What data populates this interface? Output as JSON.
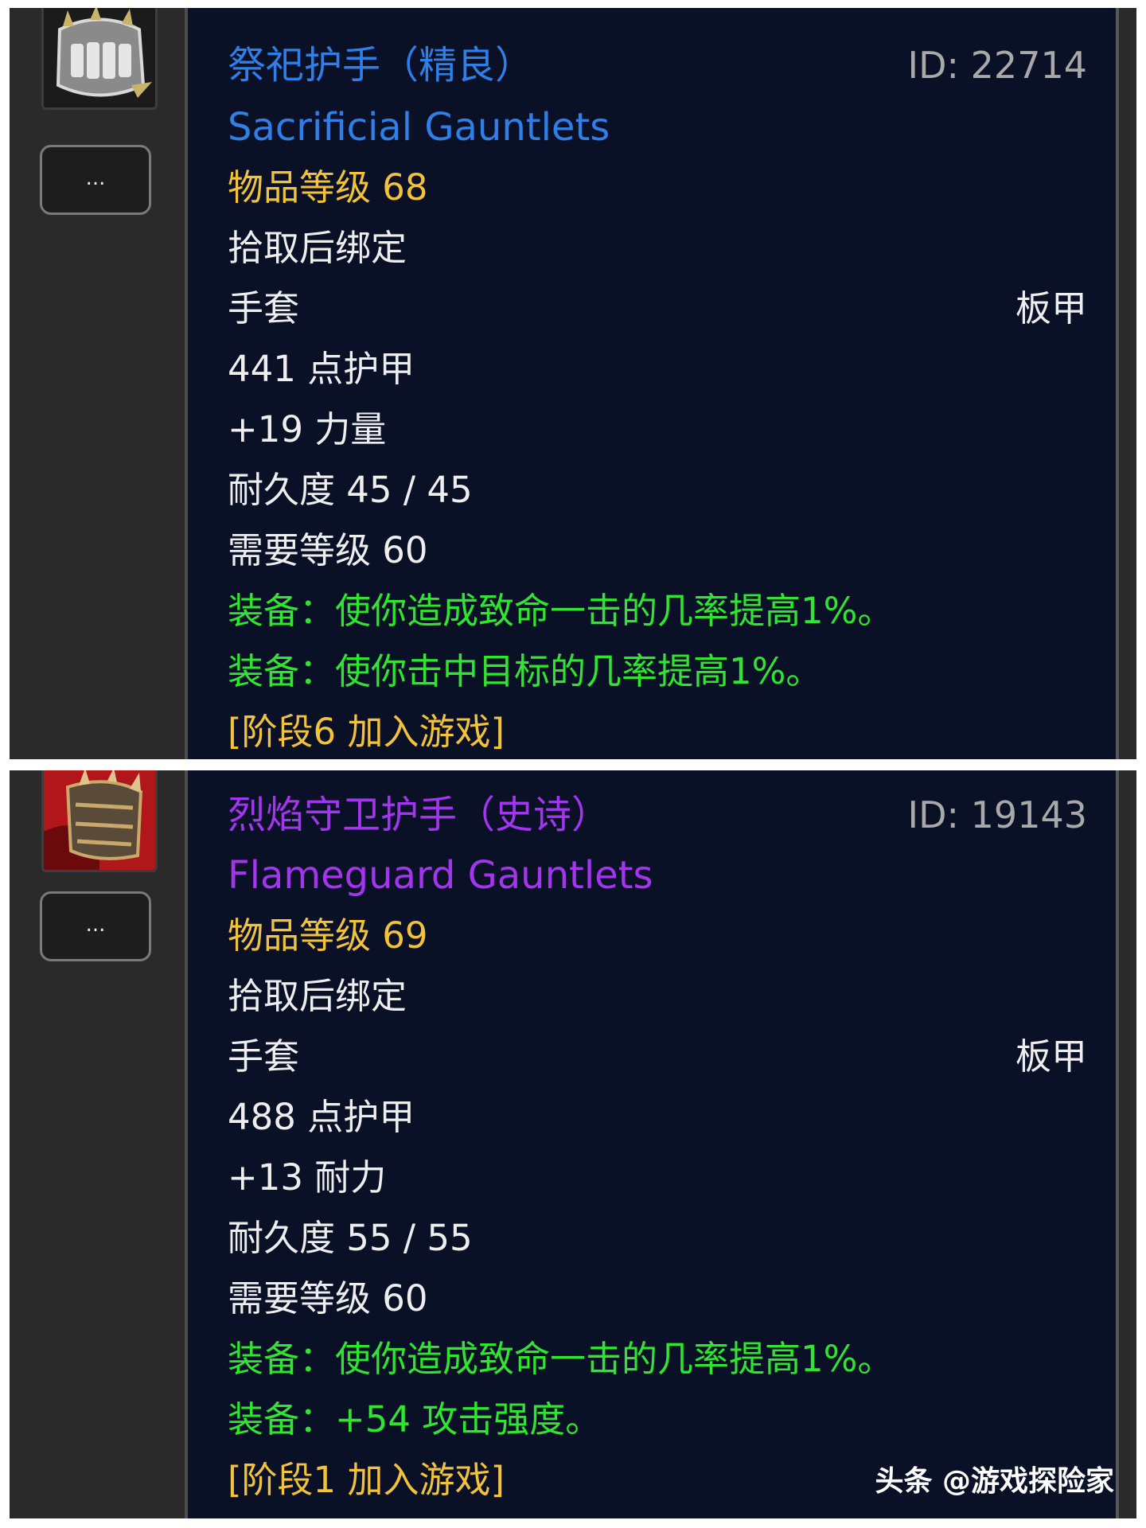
{
  "items": [
    {
      "name_cn": "祭祀护手（精良）",
      "name_en": "Sacrificial Gauntlets",
      "id_label": "ID: 22714",
      "item_level": "物品等级 68",
      "bind": "拾取后绑定",
      "slot": "手套",
      "armor_type": "板甲",
      "armor": "441 点护甲",
      "stat": "+19 力量",
      "durability": "耐久度 45 / 45",
      "required_level": "需要等级 60",
      "equip_effects": [
        "装备：使你造成致命一击的几率提高1%。",
        "装备：使你击中目标的几率提高1%。"
      ],
      "phase": "[阶段6 加入游戏]",
      "more_label": "...",
      "name_color": "#2f7fe8",
      "icon": "plate-gauntlet-icon"
    },
    {
      "name_cn": "烈焰守卫护手（史诗）",
      "name_en": "Flameguard Gauntlets",
      "id_label": "ID: 19143",
      "item_level": "物品等级 69",
      "bind": "拾取后绑定",
      "slot": "手套",
      "armor_type": "板甲",
      "armor": "488 点护甲",
      "stat": "+13 耐力",
      "durability": "耐久度 55 / 55",
      "required_level": "需要等级 60",
      "equip_effects": [
        "装备：使你造成致命一击的几率提高1%。",
        "装备：+54 攻击强度。"
      ],
      "phase": "[阶段1 加入游戏]",
      "more_label": "...",
      "name_color": "#a335ee",
      "icon": "flameguard-gauntlet-icon"
    }
  ],
  "watermark": "头条 @游戏探险家",
  "colors": {
    "tooltip_bg": "#0a1026",
    "sidebar_bg": "#2a2a2a",
    "item_level_gold": "#f2c23a",
    "equip_green": "#2fe52f",
    "id_gray": "#a9a9a9"
  }
}
